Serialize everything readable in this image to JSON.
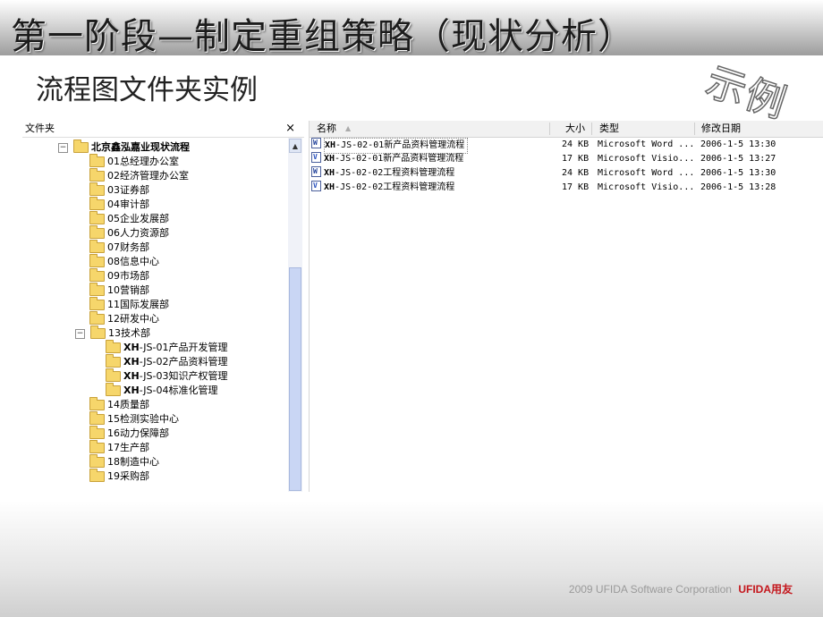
{
  "slide": {
    "title": "第一阶段—制定重组策略（现状分析）",
    "subtitle": "流程图文件夹实例",
    "stamp": "示例",
    "footer_text": "2009 UFIDA Software Corporation",
    "footer_brand": "UFIDA用友"
  },
  "folders_pane": {
    "title": "文件夹",
    "close": "×",
    "root": "北京鑫泓嘉业现状流程",
    "items": [
      "01总经理办公室",
      "02经济管理办公室",
      "03证券部",
      "04审计部",
      "05企业发展部",
      "06人力资源部",
      "07财务部",
      "08信息中心",
      "09市场部",
      "10营销部",
      "11国际发展部",
      "12研发中心",
      "13技术部"
    ],
    "subitems": [
      {
        "prefix": "XH",
        "rest": "-JS-01产品开发管理"
      },
      {
        "prefix": "XH",
        "rest": "-JS-02产品资料管理"
      },
      {
        "prefix": "XH",
        "rest": "-JS-03知识产权管理"
      },
      {
        "prefix": "XH",
        "rest": "-JS-04标准化管理"
      }
    ],
    "items_after": [
      "14质量部",
      "15检测实验中心",
      "16动力保障部",
      "17生产部",
      "18制造中心",
      "19采购部"
    ]
  },
  "files_pane": {
    "columns": {
      "name": "名称",
      "size": "大小",
      "type": "类型",
      "modified": "修改日期"
    },
    "rows": [
      {
        "prefix": "XH",
        "rest": "-JS-02-01新产品资料管理流程",
        "size": "24 KB",
        "type": "Microsoft Word ...",
        "modified": "2006-1-5 13:30",
        "icon": "word-icon"
      },
      {
        "prefix": "XH",
        "rest": "-JS-02-01新产品资料管理流程",
        "size": "17 KB",
        "type": "Microsoft Visio...",
        "modified": "2006-1-5 13:27",
        "icon": "visio-icon"
      },
      {
        "prefix": "XH",
        "rest": "-JS-02-02工程资料管理流程",
        "size": "24 KB",
        "type": "Microsoft Word ...",
        "modified": "2006-1-5 13:30",
        "icon": "word-icon"
      },
      {
        "prefix": "XH",
        "rest": "-JS-02-02工程资料管理流程",
        "size": "17 KB",
        "type": "Microsoft Visio...",
        "modified": "2006-1-5 13:28",
        "icon": "visio-icon"
      }
    ]
  }
}
